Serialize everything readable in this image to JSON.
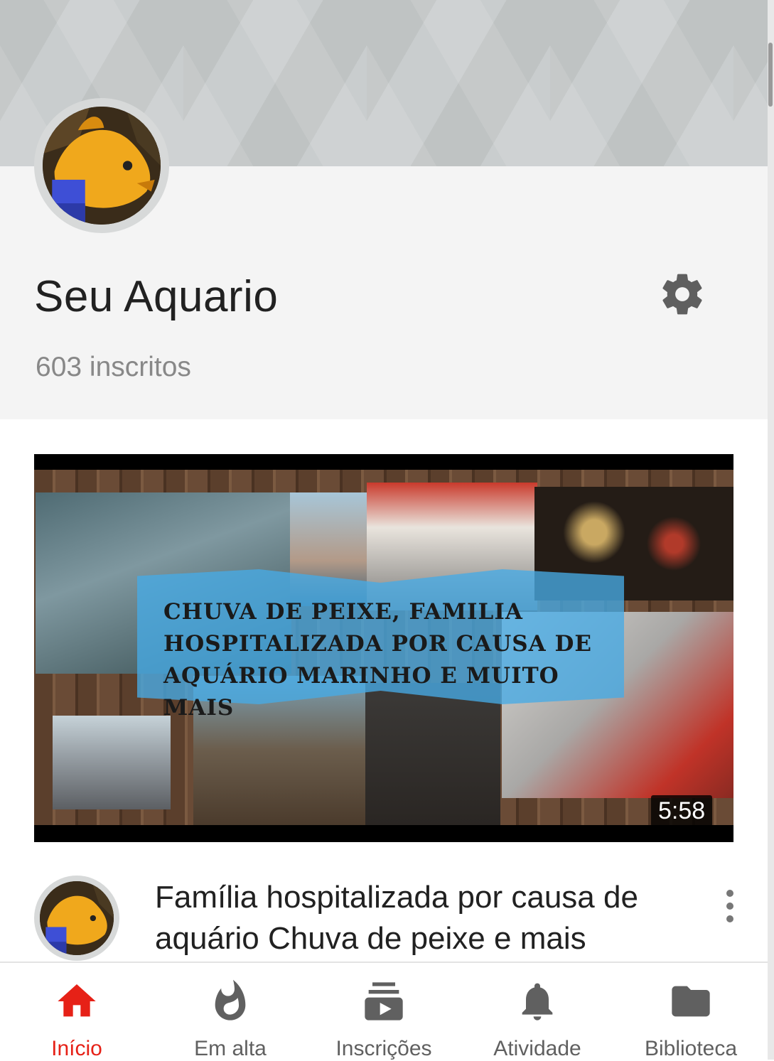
{
  "channel": {
    "name": "Seu Aquario",
    "subscribers": "603 inscritos"
  },
  "video": {
    "thumbnail_text": "CHUVA DE PEIXE, FAMILIA HOSPITALIZADA POR CAUSA DE AQUÁRIO MARINHO E MUITO MAIS",
    "duration": "5:58",
    "title": "Família hospitalizada por causa de aquário Chuva de peixe e mais"
  },
  "nav": [
    {
      "label": "Início",
      "icon": "home-icon",
      "active": true
    },
    {
      "label": "Em alta",
      "icon": "flame-icon",
      "active": false
    },
    {
      "label": "Inscrições",
      "icon": "subscriptions-icon",
      "active": false
    },
    {
      "label": "Atividade",
      "icon": "bell-icon",
      "active": false
    },
    {
      "label": "Biblioteca",
      "icon": "folder-icon",
      "active": false
    }
  ],
  "colors": {
    "accent": "#e62117",
    "icon_gray": "#606060",
    "header_bg": "#f4f4f4"
  }
}
